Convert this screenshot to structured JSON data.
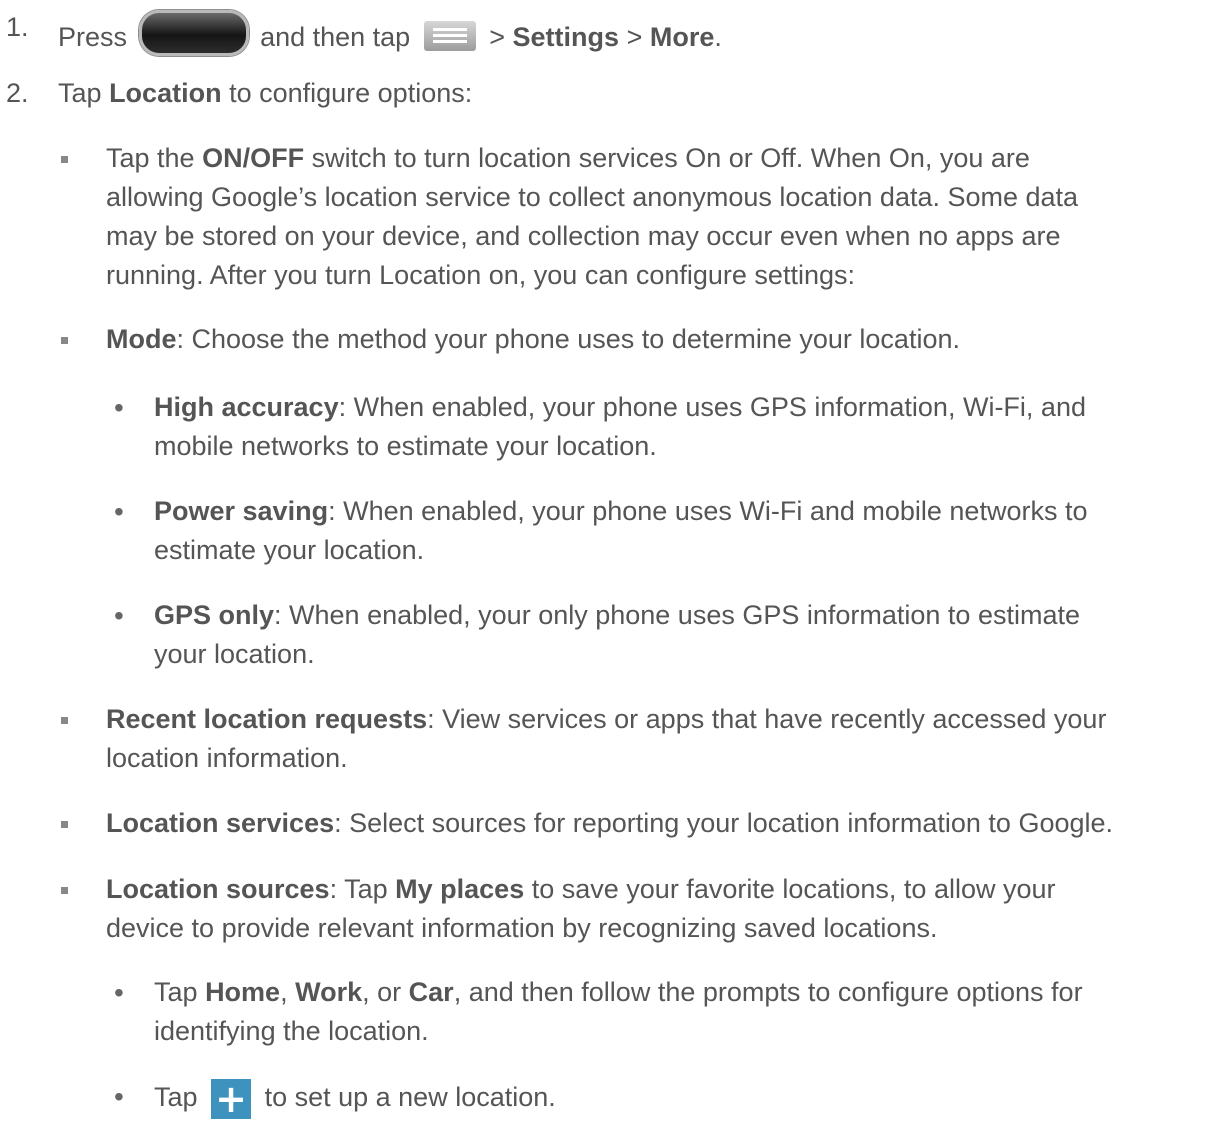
{
  "step1": {
    "number": "1.",
    "press": "Press",
    "and_then_tap": "and then tap",
    "sep1": ">",
    "settings": "Settings",
    "sep2": ">",
    "more": "More",
    "period": ".",
    "home_key_icon": "home-button-icon",
    "menu_key_icon": "menu-key-icon"
  },
  "step2": {
    "number": "2.",
    "tap": "Tap",
    "location": "Location",
    "rest": "to configure options:"
  },
  "onoff": {
    "line1_pre": "Tap the",
    "line1_bold": "ON/OFF",
    "line1_post": "switch to turn location services On or Off. When On, you are",
    "line2": "allowing Google’s location service to collect anonymous location data. Some data",
    "line3": "may be stored on your device, and collection may occur even when no apps are",
    "line4": "running. After you turn Location on, you can configure settings:"
  },
  "mode": {
    "label": "Mode",
    "text": ": Choose the method your phone uses to determine your location."
  },
  "high_accuracy": {
    "label": "High accuracy",
    "line1": ": When enabled, your phone uses GPS information, Wi-Fi, and",
    "line2": "mobile networks to estimate your location."
  },
  "power_saving": {
    "label": "Power saving",
    "line1": ": When enabled, your phone uses Wi-Fi and mobile networks to",
    "line2": "estimate your location."
  },
  "gps_only": {
    "label": "GPS only",
    "line1": ": When enabled, your only phone uses GPS information to estimate",
    "line2": "your location."
  },
  "recent_requests": {
    "label": "Recent location requests",
    "line1": ": View services or apps that have recently accessed your",
    "line2": "location information."
  },
  "location_services": {
    "label": "Location services",
    "text": ": Select sources for reporting your location information to Google."
  },
  "location_sources": {
    "label": "Location sources",
    "mid1": ": Tap",
    "my_places": "My places",
    "line1_post": "to save your favorite locations, to allow your",
    "line2": "device to provide relevant information by recognizing saved locations."
  },
  "home_work_car": {
    "tap": "Tap",
    "home": "Home",
    "comma1": ",",
    "work": "Work",
    "or": ", or",
    "car": "Car",
    "line1_post": ", and then follow the prompts to configure options for",
    "line2": "identifying the location."
  },
  "add_location": {
    "tap": "Tap",
    "plus_glyph": "+",
    "text": "to set up a new location.",
    "plus_icon": "plus-icon"
  },
  "bullet_glyph": "•"
}
